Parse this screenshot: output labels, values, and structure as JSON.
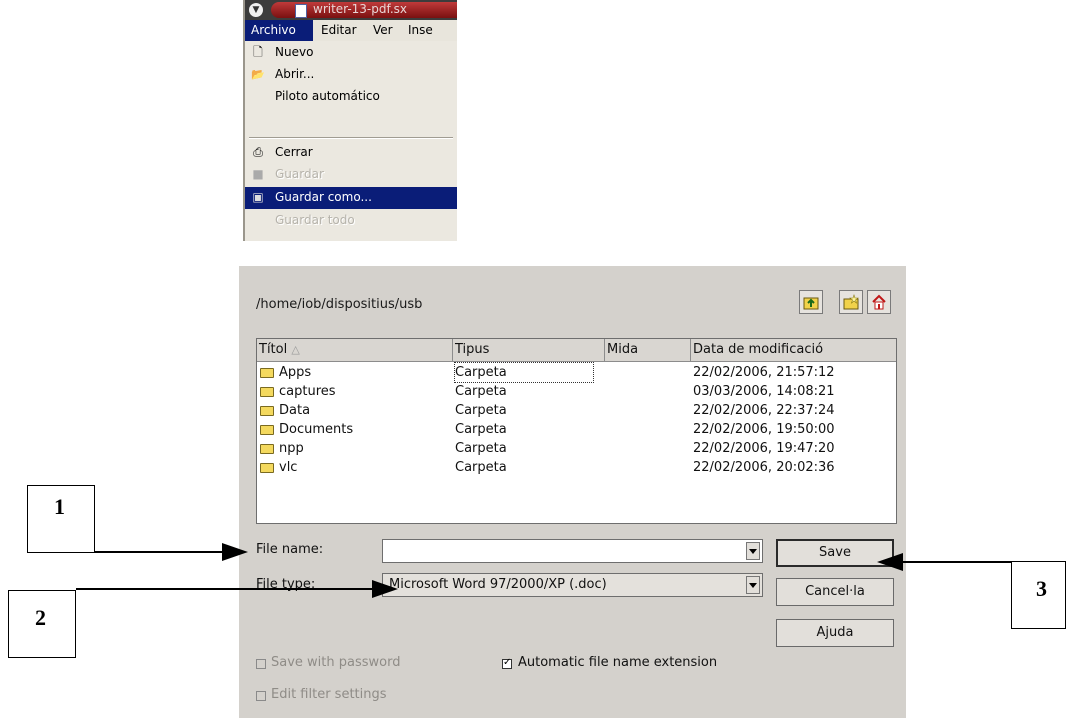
{
  "menu_window": {
    "title": "writer-13-pdf.sx",
    "menubar": [
      "Archivo",
      "Editar",
      "Ver",
      "Inse"
    ],
    "items": [
      {
        "label": "Nuevo",
        "icon": "new-document-icon",
        "state": "normal"
      },
      {
        "label": "Abrir...",
        "icon": "open-folder-icon",
        "state": "normal"
      },
      {
        "label": "Piloto automático",
        "icon": "",
        "state": "normal"
      },
      {
        "label": "Cerrar",
        "icon": "close-document-icon",
        "state": "normal"
      },
      {
        "label": "Guardar",
        "icon": "save-icon",
        "state": "disabled"
      },
      {
        "label": "Guardar como...",
        "icon": "save-as-icon",
        "state": "highlighted"
      },
      {
        "label": "Guardar todo",
        "icon": "",
        "state": "disabled"
      }
    ]
  },
  "dialog": {
    "path": "/home/iob/dispositius/usb",
    "toolbar": [
      "folder-up-icon",
      "new-folder-icon",
      "home-icon"
    ],
    "columns": [
      "Títol",
      "Tipus",
      "Mida",
      "Data de modificació"
    ],
    "sort_indicator": "△",
    "rows": [
      {
        "name": "Apps",
        "type": "Carpeta",
        "size": "",
        "date": "22/02/2006, 21:57:12"
      },
      {
        "name": "captures",
        "type": "Carpeta",
        "size": "",
        "date": "03/03/2006, 14:08:21"
      },
      {
        "name": "Data",
        "type": "Carpeta",
        "size": "",
        "date": "22/02/2006, 22:37:24"
      },
      {
        "name": "Documents",
        "type": "Carpeta",
        "size": "",
        "date": "22/02/2006, 19:50:00"
      },
      {
        "name": "npp",
        "type": "Carpeta",
        "size": "",
        "date": "22/02/2006, 19:47:20"
      },
      {
        "name": "vlc",
        "type": "Carpeta",
        "size": "",
        "date": "22/02/2006, 20:02:36"
      }
    ],
    "file_name_label": "File name:",
    "file_name_value": "",
    "file_type_label": "File type:",
    "file_type_value": "Microsoft Word 97/2000/XP (.doc)",
    "buttons": {
      "save": "Save",
      "cancel": "Cancel·la",
      "help": "Ajuda"
    },
    "options": {
      "save_with_password": {
        "label": "Save with password",
        "checked": false,
        "enabled": false
      },
      "automatic_extension": {
        "label": "Automatic file name extension",
        "checked": true,
        "enabled": true
      },
      "edit_filter": {
        "label": "Edit filter settings",
        "checked": false,
        "enabled": false
      }
    }
  },
  "callouts": [
    "1",
    "2",
    "3"
  ]
}
